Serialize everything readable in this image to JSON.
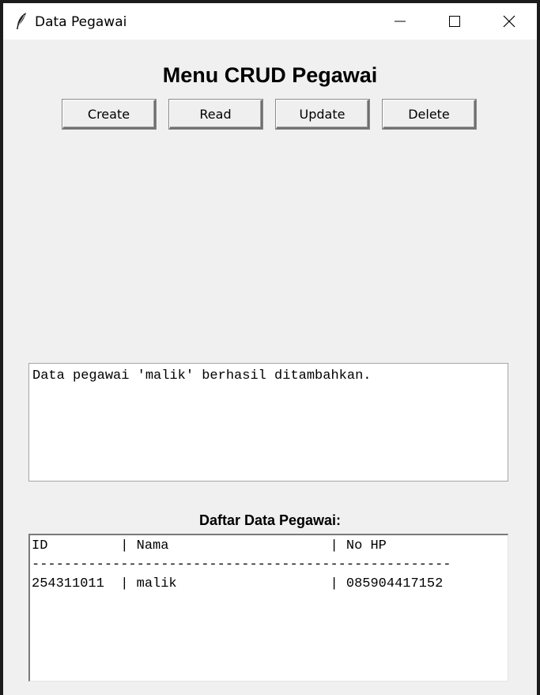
{
  "window": {
    "title": "Data Pegawai",
    "app_icon": "feather-icon",
    "controls": [
      "minimize-icon",
      "maximize-icon",
      "close-icon"
    ]
  },
  "heading": "Menu CRUD Pegawai",
  "buttons": {
    "create": "Create",
    "read": "Read",
    "update": "Update",
    "delete": "Delete"
  },
  "message": "Data pegawai 'malik' berhasil ditambahkan.",
  "list": {
    "label": "Daftar Data Pegawai:",
    "header": "ID         | Nama                    | No HP",
    "separator": "----------------------------------------------------",
    "rows": [
      "254311011  | malik                   | 085904417152"
    ]
  }
}
